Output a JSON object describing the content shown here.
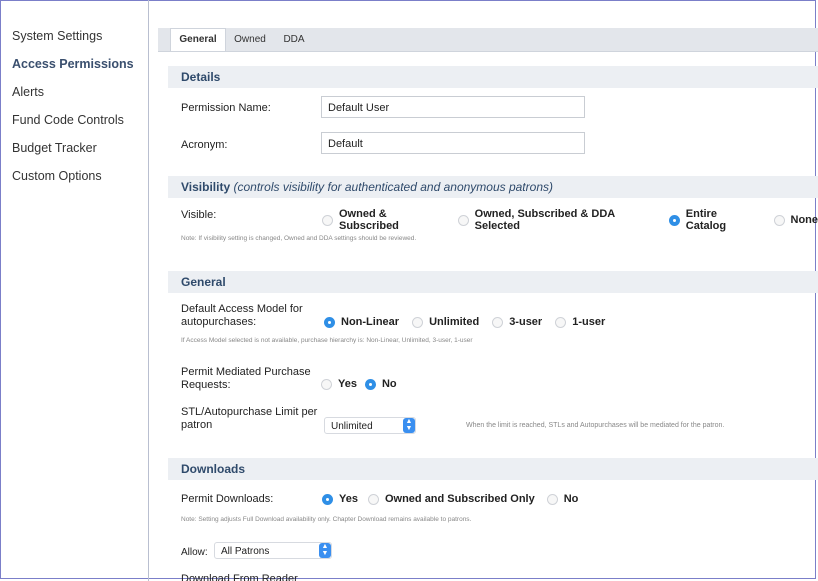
{
  "sidebar": {
    "items": [
      {
        "label": "System Settings",
        "active": false
      },
      {
        "label": "Access Permissions",
        "active": true
      },
      {
        "label": "Alerts",
        "active": false
      },
      {
        "label": "Fund Code Controls",
        "active": false
      },
      {
        "label": "Budget Tracker",
        "active": false
      },
      {
        "label": "Custom Options",
        "active": false
      }
    ]
  },
  "tabs": [
    {
      "label": "General",
      "active": true
    },
    {
      "label": "Owned",
      "active": false
    },
    {
      "label": "DDA",
      "active": false
    }
  ],
  "details": {
    "heading": "Details",
    "permission_name_label": "Permission Name:",
    "permission_name_value": "Default User",
    "acronym_label": "Acronym:",
    "acronym_value": "Default"
  },
  "visibility": {
    "heading": "Visibility",
    "heading_note": "(controls visibility for authenticated and anonymous patrons)",
    "visible_label": "Visible:",
    "options": [
      "Owned & Subscribed",
      "Owned, Subscribed & DDA Selected",
      "Entire Catalog",
      "None"
    ],
    "selected": "Entire Catalog",
    "note": "Note: If visibility setting is changed, Owned and DDA settings should be reviewed."
  },
  "general": {
    "heading": "General",
    "access_model_label_1": "Default Access Model for",
    "access_model_label_2": "autopurchases:",
    "access_model_options": [
      "Non-Linear",
      "Unlimited",
      "3-user",
      "1-user"
    ],
    "access_model_selected": "Non-Linear",
    "access_model_note": "If Access Model selected is not available, purchase hierarchy is: Non-Linear, Unlimited, 3-user, 1-user",
    "mediated_label_1": "Permit Mediated Purchase",
    "mediated_label_2": "Requests:",
    "mediated_options": [
      "Yes",
      "No"
    ],
    "mediated_selected": "No",
    "stl_label_1": "STL/Autopurchase Limit per",
    "stl_label_2": "patron",
    "stl_value": "Unlimited",
    "stl_note": "When the limit is reached, STLs and Autopurchases will be mediated for the patron."
  },
  "downloads": {
    "heading": "Downloads",
    "permit_label": "Permit Downloads:",
    "permit_options": [
      "Yes",
      "Owned and Subscribed Only",
      "No"
    ],
    "permit_selected": "Yes",
    "permit_note": "Note: Setting adjusts Full Download availability only. Chapter Download remains available to patrons.",
    "allow_label": "Allow:",
    "allow_value": "All Patrons",
    "download_from_reader_label": "Download From Reader"
  },
  "colors": {
    "accent": "#2f8fe6",
    "heading_text": "#2f4a6b",
    "section_bg": "#eceff3",
    "frame_border": "#7b7fc9"
  }
}
